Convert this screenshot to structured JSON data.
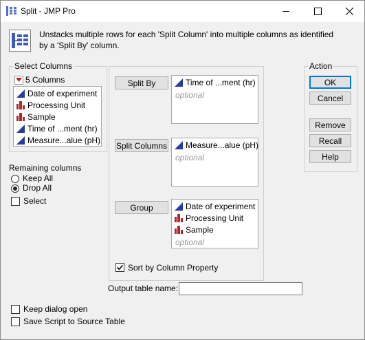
{
  "window": {
    "title": "Split - JMP Pro"
  },
  "description": "Unstacks multiple rows for each 'Split Column' into multiple columns as identified by a 'Split By' column.",
  "select_columns": {
    "title": "Select Columns",
    "count_label": "5 Columns",
    "items": [
      {
        "label": "Date of experiment",
        "icon": "continuous-icon"
      },
      {
        "label": "Processing Unit",
        "icon": "nominal-icon"
      },
      {
        "label": "Sample",
        "icon": "nominal-icon"
      },
      {
        "label": "Time of ...ment (hr)",
        "icon": "continuous-icon"
      },
      {
        "label": "Measure...alue (pH)",
        "icon": "continuous-icon"
      }
    ]
  },
  "remaining": {
    "title": "Remaining columns",
    "keep_all": "Keep All",
    "drop_all": "Drop All",
    "selected": "drop_all",
    "select_label": "Select"
  },
  "roles": {
    "split_by": {
      "button": "Split By",
      "items": [
        "Time of ...ment (hr)"
      ],
      "optional": "optional"
    },
    "split_columns": {
      "button": "Split Columns",
      "items": [
        "Measure...alue (pH)"
      ],
      "optional": "optional"
    },
    "group": {
      "button": "Group",
      "items": [
        {
          "label": "Date of experiment",
          "icon": "continuous-icon"
        },
        {
          "label": "Processing Unit",
          "icon": "nominal-icon"
        },
        {
          "label": "Sample",
          "icon": "nominal-icon"
        }
      ],
      "optional": "optional"
    },
    "sort_by_property": {
      "label": "Sort by Column Property",
      "checked": true
    }
  },
  "output": {
    "label": "Output table name:",
    "value": ""
  },
  "action": {
    "title": "Action",
    "ok": "OK",
    "cancel": "Cancel",
    "remove": "Remove",
    "recall": "Recall",
    "help": "Help"
  },
  "options": {
    "keep_open": "Keep dialog open",
    "save_script": "Save Script to Source Table"
  },
  "colors": {
    "accent": "#0078d7",
    "continuous": "#2a3b9e",
    "nominal": "#b0282a"
  }
}
